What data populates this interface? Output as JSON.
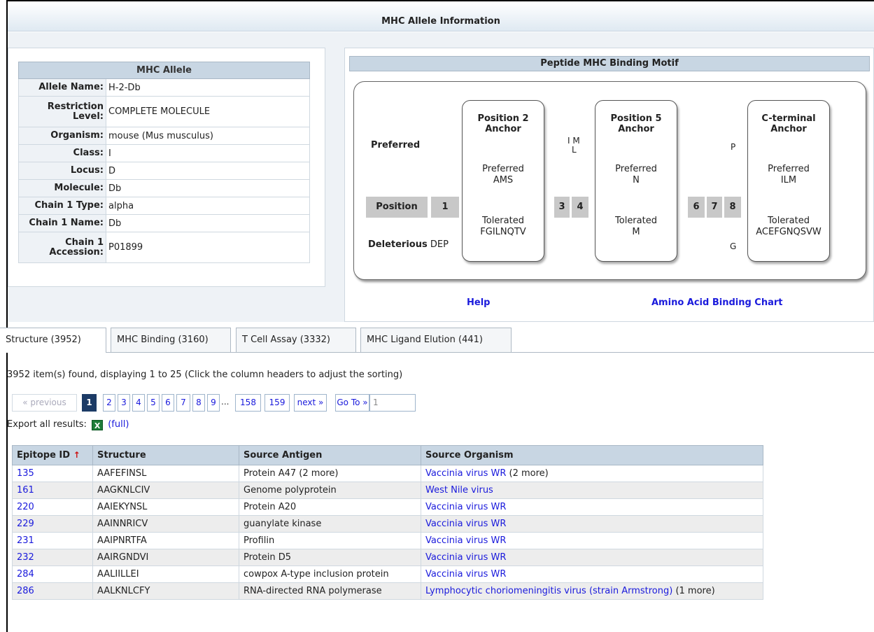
{
  "header": {
    "title": "MHC Allele Information"
  },
  "allele": {
    "caption": "MHC Allele",
    "rows": [
      {
        "label": "Allele Name:",
        "value": "H-2-Db"
      },
      {
        "label": "Restriction Level:",
        "value": "COMPLETE MOLECULE"
      },
      {
        "label": "Organism:",
        "value": "mouse (Mus musculus)"
      },
      {
        "label": "Class:",
        "value": "I"
      },
      {
        "label": "Locus:",
        "value": "D"
      },
      {
        "label": "Molecule:",
        "value": "Db"
      },
      {
        "label": "Chain 1 Type:",
        "value": "alpha"
      },
      {
        "label": "Chain 1 Name:",
        "value": "Db"
      },
      {
        "label": "Chain 1 Accession:",
        "value": "P01899"
      }
    ]
  },
  "motif": {
    "title": "Peptide MHC Binding Motif",
    "preferred_label": "Preferred",
    "deleterious_label": "Deleterious",
    "deleterious_p1": "DEP",
    "position_label": "Position",
    "positions": [
      "1",
      "3",
      "4",
      "6",
      "7",
      "8"
    ],
    "p3_preferred_line1": "I M",
    "p3_preferred_line2": "L",
    "p8_preferred": "P",
    "p8_deleterious": "G",
    "anchors": [
      {
        "title1": "Position 2",
        "title2": "Anchor",
        "pref_label": "Preferred",
        "pref": "AMS",
        "tol_label": "Tolerated",
        "tol": "FGILNQTV"
      },
      {
        "title1": "Position 5",
        "title2": "Anchor",
        "pref_label": "Preferred",
        "pref": "N",
        "tol_label": "Tolerated",
        "tol": "M"
      },
      {
        "title1": "C-terminal",
        "title2": "Anchor",
        "pref_label": "Preferred",
        "pref": "ILM",
        "tol_label": "Tolerated",
        "tol": "ACEFGNQSVW"
      }
    ],
    "help_link": "Help",
    "chart_link": "Amino Acid Binding Chart"
  },
  "tabs": [
    {
      "label": "Structure (3952)"
    },
    {
      "label": "MHC Binding (3160)"
    },
    {
      "label": "T Cell Assay (3332)"
    },
    {
      "label": "MHC Ligand Elution (441)"
    }
  ],
  "results_info": "3952 item(s) found, displaying 1 to 25 (Click the column headers to adjust the sorting)",
  "pager": {
    "previous": "« previous",
    "pages": [
      "1",
      "2",
      "3",
      "4",
      "5",
      "6",
      "7",
      "8",
      "9"
    ],
    "ellipsis": "...",
    "last_pages": [
      "158",
      "159"
    ],
    "next": "next »",
    "goto": "Go To »",
    "goto_value": "1"
  },
  "export": {
    "label": "Export all results:",
    "icon_text": "X",
    "full_link": "(full)"
  },
  "table": {
    "columns": [
      "Epitope ID",
      "Structure",
      "Source Antigen",
      "Source Organism"
    ],
    "sort_indicator": "↑",
    "rows": [
      {
        "id": "135",
        "structure": "AAFEFINSL",
        "antigen": "Protein A47 (2 more)",
        "organism": "Vaccinia virus WR",
        "organism_extra": "(2 more)"
      },
      {
        "id": "161",
        "structure": "AAGKNLCIV",
        "antigen": "Genome polyprotein",
        "organism": "West Nile virus",
        "organism_extra": ""
      },
      {
        "id": "220",
        "structure": "AAIEKYNSL",
        "antigen": "Protein A20",
        "organism": "Vaccinia virus WR",
        "organism_extra": ""
      },
      {
        "id": "229",
        "structure": "AAINNRICV",
        "antigen": "guanylate kinase",
        "organism": "Vaccinia virus WR",
        "organism_extra": ""
      },
      {
        "id": "231",
        "structure": "AAIPNRTFA",
        "antigen": "Profilin",
        "organism": "Vaccinia virus WR",
        "organism_extra": ""
      },
      {
        "id": "232",
        "structure": "AAIRGNDVI",
        "antigen": "Protein D5",
        "organism": "Vaccinia virus WR",
        "organism_extra": ""
      },
      {
        "id": "284",
        "structure": "AALIILLEI",
        "antigen": "cowpox A-type inclusion protein",
        "organism": "Vaccinia virus WR",
        "organism_extra": ""
      },
      {
        "id": "286",
        "structure": "AALKNLCFY",
        "antigen": "RNA-directed RNA polymerase",
        "organism": "Lymphocytic choriomeningitis virus (strain Armstrong)",
        "organism_extra": "(1 more)"
      }
    ]
  }
}
